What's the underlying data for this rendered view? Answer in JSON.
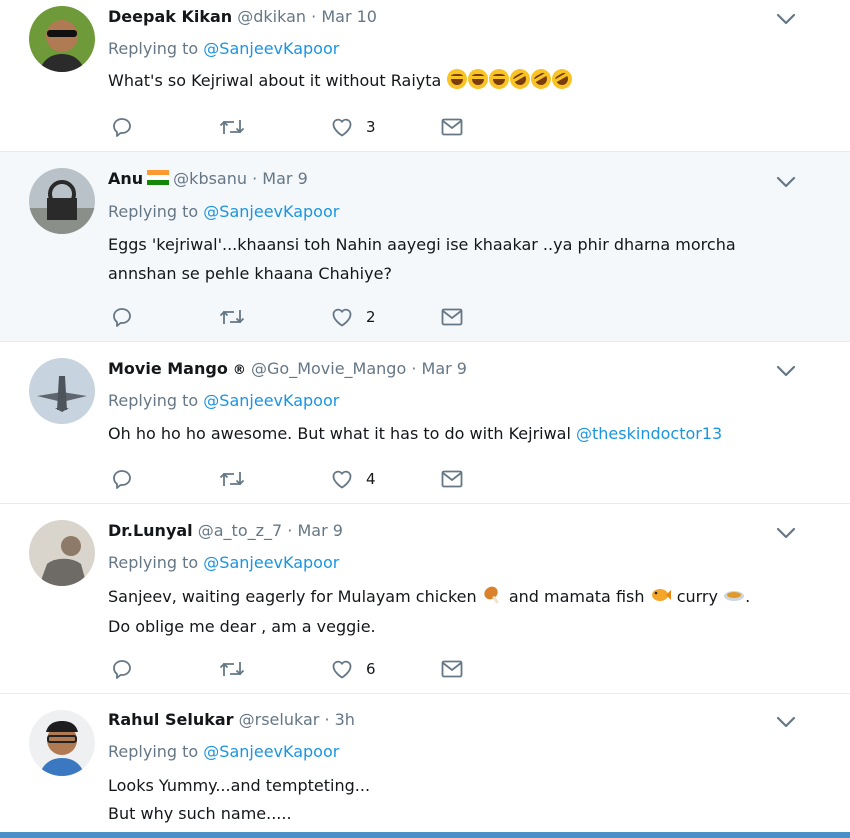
{
  "tweets": [
    {
      "name": "Deepak Kikan",
      "handle": "@dkikan",
      "sep": "·",
      "date": "Mar 10",
      "replying_to": "Replying to",
      "reply_mention": "@SanjeevKapoor",
      "text": [
        "What's so Kejriwal about it without Raiyta"
      ],
      "likes": "3"
    },
    {
      "name": "Anu",
      "handle": "@kbsanu",
      "sep": "·",
      "date": "Mar 9",
      "replying_to": "Replying to",
      "reply_mention": "@SanjeevKapoor",
      "text": [
        "Eggs 'kejriwal'...khaansi toh Nahin aayegi ise khaakar ..ya phir dharna morcha",
        "annshan se pehle khaana Chahiye?"
      ],
      "likes": "2"
    },
    {
      "name": "Movie Mango",
      "badge": "®",
      "handle": "@Go_Movie_Mango",
      "sep": "·",
      "date": "Mar 9",
      "replying_to": "Replying to",
      "reply_mention": "@SanjeevKapoor",
      "text": [
        "Oh ho ho ho awesome. But what it has to do with Kejriwal"
      ],
      "text_mention": "@theskindoctor13",
      "likes": "4"
    },
    {
      "name": "Dr.Lunyal",
      "handle": "@a_to_z_7",
      "sep": "·",
      "date": "Mar 9",
      "replying_to": "Replying to",
      "reply_mention": "@SanjeevKapoor",
      "text_parts": [
        "Sanjeev, waiting eagerly for Mulayam chicken",
        "and mamata fish",
        "curry",
        "."
      ],
      "text": [
        "",
        "Do oblige me dear , am a veggie."
      ],
      "likes": "6"
    },
    {
      "name": "Rahul Selukar",
      "handle": "@rselukar",
      "sep": "·",
      "date": "3h",
      "replying_to": "Replying to",
      "reply_mention": "@SanjeevKapoor",
      "text": [
        "Looks Yummy...and tempteting...",
        "But why such name....."
      ]
    }
  ],
  "icons": {
    "reply": "reply-icon",
    "retweet": "retweet-icon",
    "like": "heart-icon",
    "dm": "envelope-icon",
    "more": "chevron-down-icon"
  },
  "colors": {
    "link": "#1b95e0",
    "meta": "#657786",
    "highlight_bg": "#f5f8fa"
  }
}
